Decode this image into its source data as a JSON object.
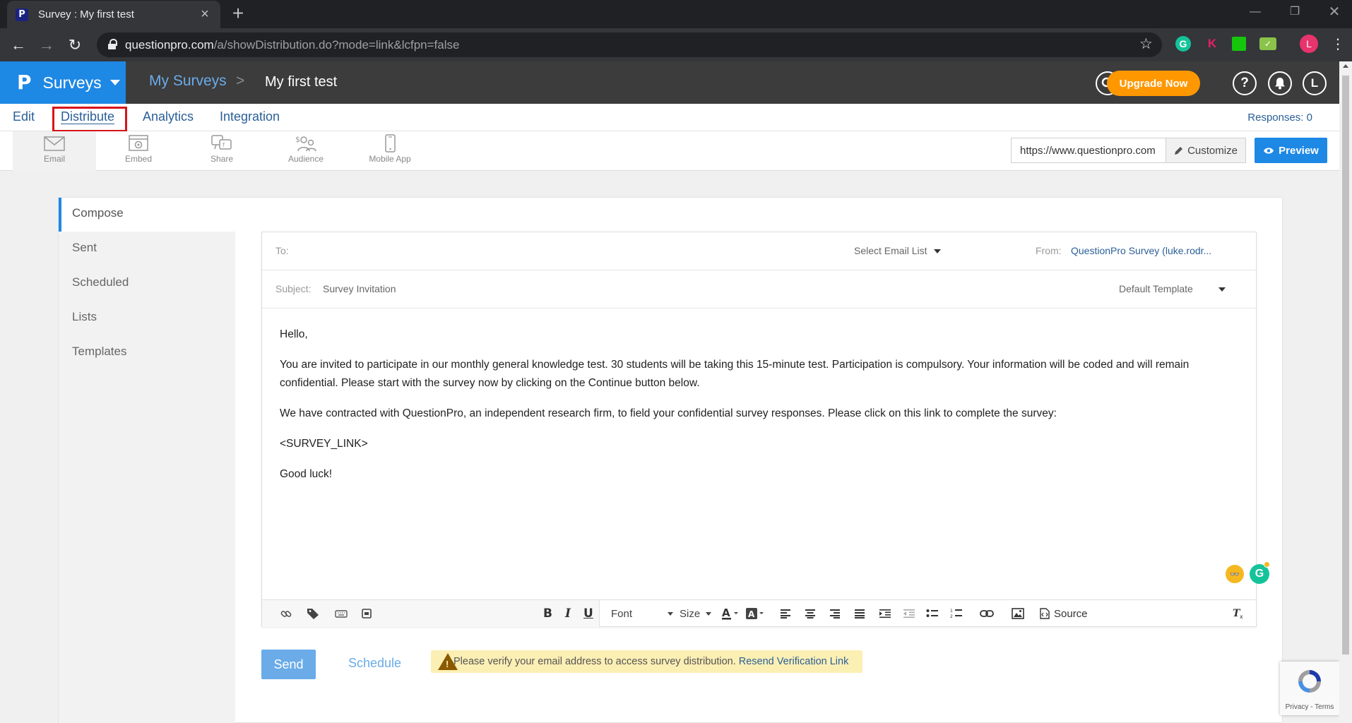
{
  "browser": {
    "tab_title": "Survey : My first test",
    "favicon_letter": "P",
    "url_host": "questionpro.com",
    "url_path": "/a/showDistribution.do?mode=link&lcfpn=false",
    "profile_initial": "L",
    "ext_k_letter": "K",
    "ext_g_letter": "G"
  },
  "header": {
    "brand_logo": "P",
    "brand_label": "Surveys",
    "crumb_parent": "My Surveys",
    "crumb_separator": ">",
    "crumb_current": "My first test",
    "upgrade_label": "Upgrade Now",
    "user_initial": "L"
  },
  "subnav": {
    "items": [
      {
        "label": "Edit"
      },
      {
        "label": "Distribute"
      },
      {
        "label": "Analytics"
      },
      {
        "label": "Integration"
      }
    ],
    "responses": "Responses: 0"
  },
  "toolbar": {
    "tools": [
      {
        "label": "Email",
        "icon": "envelope-icon"
      },
      {
        "label": "Embed",
        "icon": "embed-icon"
      },
      {
        "label": "Share",
        "icon": "share-icon"
      },
      {
        "label": "Audience",
        "icon": "audience-icon"
      },
      {
        "label": "Mobile App",
        "icon": "mobile-icon"
      }
    ],
    "survey_url": "https://www.questionpro.com",
    "customize_label": "Customize",
    "preview_label": "Preview"
  },
  "sidenav": {
    "items": [
      {
        "label": "Compose"
      },
      {
        "label": "Sent"
      },
      {
        "label": "Scheduled"
      },
      {
        "label": "Lists"
      },
      {
        "label": "Templates"
      }
    ]
  },
  "compose": {
    "to_label": "To:",
    "email_list_select": "Select Email List",
    "from_label": "From:",
    "from_value": "QuestionPro Survey (luke.rodr...",
    "subject_label": "Subject:",
    "subject_value": "Survey Invitation",
    "template_select": "Default Template",
    "body": [
      "Hello,",
      "You are invited to participate in our monthly general knowledge test. 30 students will be taking this 15-minute test. Participation is compulsory. Your information will be coded and will remain confidential. Please start with the survey now by clicking on the Continue button below.",
      "We have contracted with QuestionPro, an independent research firm, to field your confidential survey responses. Please click on this link to complete the survey:",
      "<SURVEY_LINK>",
      "Good luck!"
    ],
    "grammarly_letter": "G"
  },
  "editor": {
    "font_label": "Font",
    "size_label": "Size",
    "source_label": "Source",
    "bold": "B",
    "italic": "I",
    "underline": "U"
  },
  "actions": {
    "send_label": "Send",
    "schedule_label": "Schedule",
    "alert_text": "Please verify your email address to access survey distribution.",
    "alert_link": "Resend Verification Link"
  },
  "recaptcha": {
    "links": "Privacy - Terms"
  }
}
